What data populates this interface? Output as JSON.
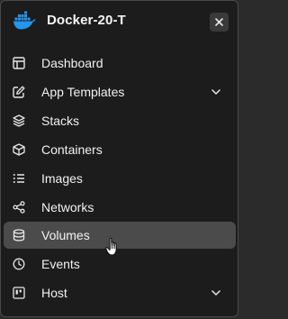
{
  "environment": {
    "name": "Docker-20-T",
    "logo_icon": "docker-whale-icon",
    "close_icon": "close-icon",
    "accent_color": "#2496ed"
  },
  "sidebar": {
    "items": [
      {
        "label": "Dashboard",
        "icon": "dashboard-icon",
        "has_submenu": false,
        "active": false
      },
      {
        "label": "App Templates",
        "icon": "edit-icon",
        "has_submenu": true,
        "active": false
      },
      {
        "label": "Stacks",
        "icon": "layers-icon",
        "has_submenu": false,
        "active": false
      },
      {
        "label": "Containers",
        "icon": "box-icon",
        "has_submenu": false,
        "active": false
      },
      {
        "label": "Images",
        "icon": "list-icon",
        "has_submenu": false,
        "active": false
      },
      {
        "label": "Networks",
        "icon": "share-icon",
        "has_submenu": false,
        "active": false
      },
      {
        "label": "Volumes",
        "icon": "database-icon",
        "has_submenu": false,
        "active": true
      },
      {
        "label": "Events",
        "icon": "clock-icon",
        "has_submenu": false,
        "active": false
      },
      {
        "label": "Host",
        "icon": "server-icon",
        "has_submenu": true,
        "active": false
      }
    ],
    "active_background": "#4b4b4b"
  }
}
